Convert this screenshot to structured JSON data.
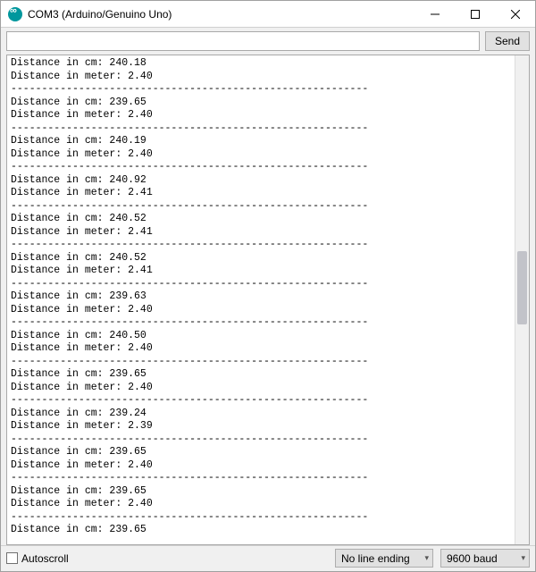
{
  "window": {
    "title": "COM3 (Arduino/Genuino Uno)"
  },
  "toolbar": {
    "send_label": "Send",
    "input_value": ""
  },
  "console": {
    "separator": "----------------------------------------------------------",
    "label_cm": "Distance in cm: ",
    "label_m": "Distance in meter: ",
    "readings": [
      {
        "cm": "240.18",
        "m": "2.40"
      },
      {
        "cm": "239.65",
        "m": "2.40"
      },
      {
        "cm": "240.19",
        "m": "2.40"
      },
      {
        "cm": "240.92",
        "m": "2.41"
      },
      {
        "cm": "240.52",
        "m": "2.41"
      },
      {
        "cm": "240.52",
        "m": "2.41"
      },
      {
        "cm": "239.63",
        "m": "2.40"
      },
      {
        "cm": "240.50",
        "m": "2.40"
      },
      {
        "cm": "239.65",
        "m": "2.40"
      },
      {
        "cm": "239.24",
        "m": "2.39"
      },
      {
        "cm": "239.65",
        "m": "2.40"
      },
      {
        "cm": "239.65",
        "m": "2.40"
      }
    ],
    "trailing_partial_cm": "239.65"
  },
  "footer": {
    "autoscroll_label": "Autoscroll",
    "autoscroll_checked": false,
    "line_ending_selected": "No line ending",
    "baud_selected": "9600 baud"
  },
  "icons": {
    "app": "arduino-icon",
    "minimize": "minimize-icon",
    "maximize": "maximize-icon",
    "close": "close-icon",
    "dropdown": "chevron-down-icon"
  }
}
